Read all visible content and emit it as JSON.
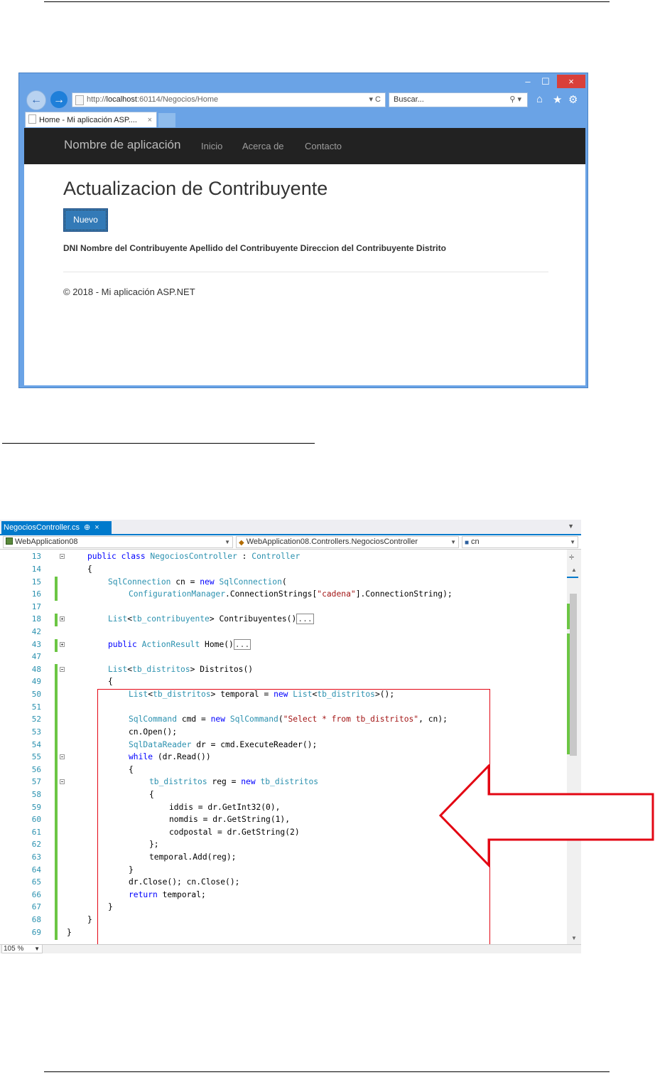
{
  "browser": {
    "window_controls": {
      "minimize": "–",
      "maximize": "☐",
      "close": "×"
    },
    "address_url_prefix": "http://",
    "address_url_host": "localhost",
    "address_url_rest": ":60114/Negocios/Home",
    "address_controls": "▾ C",
    "search_placeholder": "Buscar...",
    "search_controls": "⚲ ▾",
    "tab_title": "Home - Mi aplicación ASP....",
    "tab_close": "×",
    "app": {
      "brand": "Nombre de aplicación",
      "nav": [
        "Inicio",
        "Acerca de",
        "Contacto"
      ],
      "page_title": "Actualizacion de Contribuyente",
      "new_button": "Nuevo",
      "table_headers": "DNI Nombre del Contribuyente Apellido del Contribuyente Direccion del Contribuyente Distrito",
      "footer": "© 2018 - Mi aplicación ASP.NET"
    }
  },
  "vs": {
    "tab_label": "NegociosController.cs",
    "tab_pin": "⊕",
    "tab_close": "×",
    "project_dropdown": "WebApplication08",
    "class_dropdown": "WebApplication08.Controllers.NegociosController",
    "member_dropdown": "cn",
    "zoom": "105 %",
    "line_numbers": [
      "13",
      "14",
      "15",
      "16",
      "17",
      "18",
      "42",
      "43",
      "47",
      "48",
      "49",
      "50",
      "51",
      "52",
      "53",
      "54",
      "55",
      "56",
      "57",
      "58",
      "59",
      "60",
      "61",
      "62",
      "63",
      "64",
      "65",
      "66",
      "67",
      "68",
      "69"
    ]
  },
  "colors": {
    "highlight_box": "#e30613",
    "arrow": "#e30613",
    "vs_accent": "#007acc",
    "changed_bar": "#6cc644"
  }
}
